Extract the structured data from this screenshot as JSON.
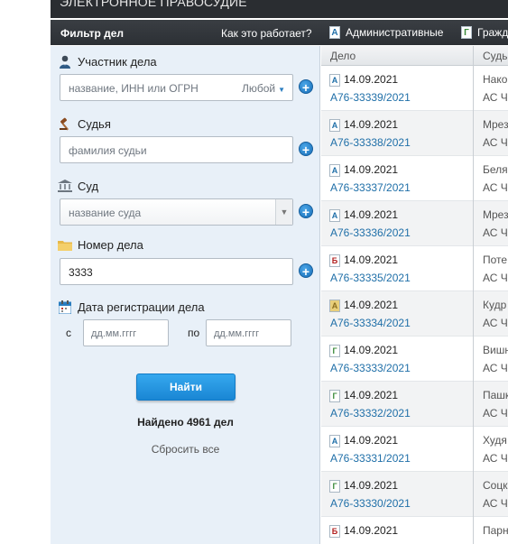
{
  "app": {
    "title": "ЭЛЕКТРОННОЕ ПРАВОСУДИЕ"
  },
  "nav": {
    "filter_title": "Фильтр дел",
    "how_it_works": "Как это работает?",
    "tabs": [
      {
        "icon": "А",
        "label": "Административные",
        "color": "#1f6fa8"
      },
      {
        "icon": "Г",
        "label": "Гражд",
        "color": "#3a8a3a"
      }
    ]
  },
  "filter": {
    "participant": {
      "label": "Участник дела",
      "placeholder": "название, ИНН или ОГРН",
      "mode": "Любой"
    },
    "judge": {
      "label": "Судья",
      "placeholder": "фамилия судьи"
    },
    "court": {
      "label": "Суд",
      "placeholder": "название суда"
    },
    "case_number": {
      "label": "Номер дела",
      "value": "3333"
    },
    "reg_date": {
      "label": "Дата регистрации дела",
      "from_label": "с",
      "to_label": "по",
      "from_placeholder": "дд.мм.гггг",
      "to_placeholder": "дд.мм.гггг"
    },
    "find_button": "Найти",
    "found_text": "Найдено 4961 дел",
    "reset_text": "Сбросить все"
  },
  "table": {
    "headers": {
      "case": "Дело",
      "court": "Судь"
    },
    "rows": [
      {
        "type_icon": "А",
        "type_color": "#1f6fa8",
        "date": "14.09.2021",
        "number": "А76-33339/2021",
        "c1": "Нако",
        "c2": "АС Ч"
      },
      {
        "type_icon": "А",
        "type_color": "#1f6fa8",
        "date": "14.09.2021",
        "number": "А76-33338/2021",
        "c1": "Мрез",
        "c2": "АС Ч"
      },
      {
        "type_icon": "А",
        "type_color": "#1f6fa8",
        "date": "14.09.2021",
        "number": "А76-33337/2021",
        "c1": "Беля",
        "c2": "АС Ч"
      },
      {
        "type_icon": "А",
        "type_color": "#1f6fa8",
        "date": "14.09.2021",
        "number": "А76-33336/2021",
        "c1": "Мрез",
        "c2": "АС Ч"
      },
      {
        "type_icon": "Б",
        "type_color": "#b22222",
        "date": "14.09.2021",
        "number": "А76-33335/2021",
        "c1": "Поте",
        "c2": "АС Ч"
      },
      {
        "type_icon": "А",
        "type_color": "#8a6d1f",
        "date": "14.09.2021",
        "number": "А76-33334/2021",
        "c1": "Кудр",
        "c2": "АС Ч"
      },
      {
        "type_icon": "Г",
        "type_color": "#3a8a3a",
        "date": "14.09.2021",
        "number": "А76-33333/2021",
        "c1": "Вишн",
        "c2": "АС Ч"
      },
      {
        "type_icon": "Г",
        "type_color": "#3a8a3a",
        "date": "14.09.2021",
        "number": "А76-33332/2021",
        "c1": "Пашк",
        "c2": "АС Ч"
      },
      {
        "type_icon": "А",
        "type_color": "#1f6fa8",
        "date": "14.09.2021",
        "number": "А76-33331/2021",
        "c1": "Худя",
        "c2": "АС Ч"
      },
      {
        "type_icon": "Г",
        "type_color": "#3a8a3a",
        "date": "14.09.2021",
        "number": "А76-33330/2021",
        "c1": "Соцк",
        "c2": "АС Ч"
      },
      {
        "type_icon": "Б",
        "type_color": "#b22222",
        "date": "14.09.2021",
        "number": "",
        "c1": "Парн",
        "c2": ""
      }
    ]
  }
}
